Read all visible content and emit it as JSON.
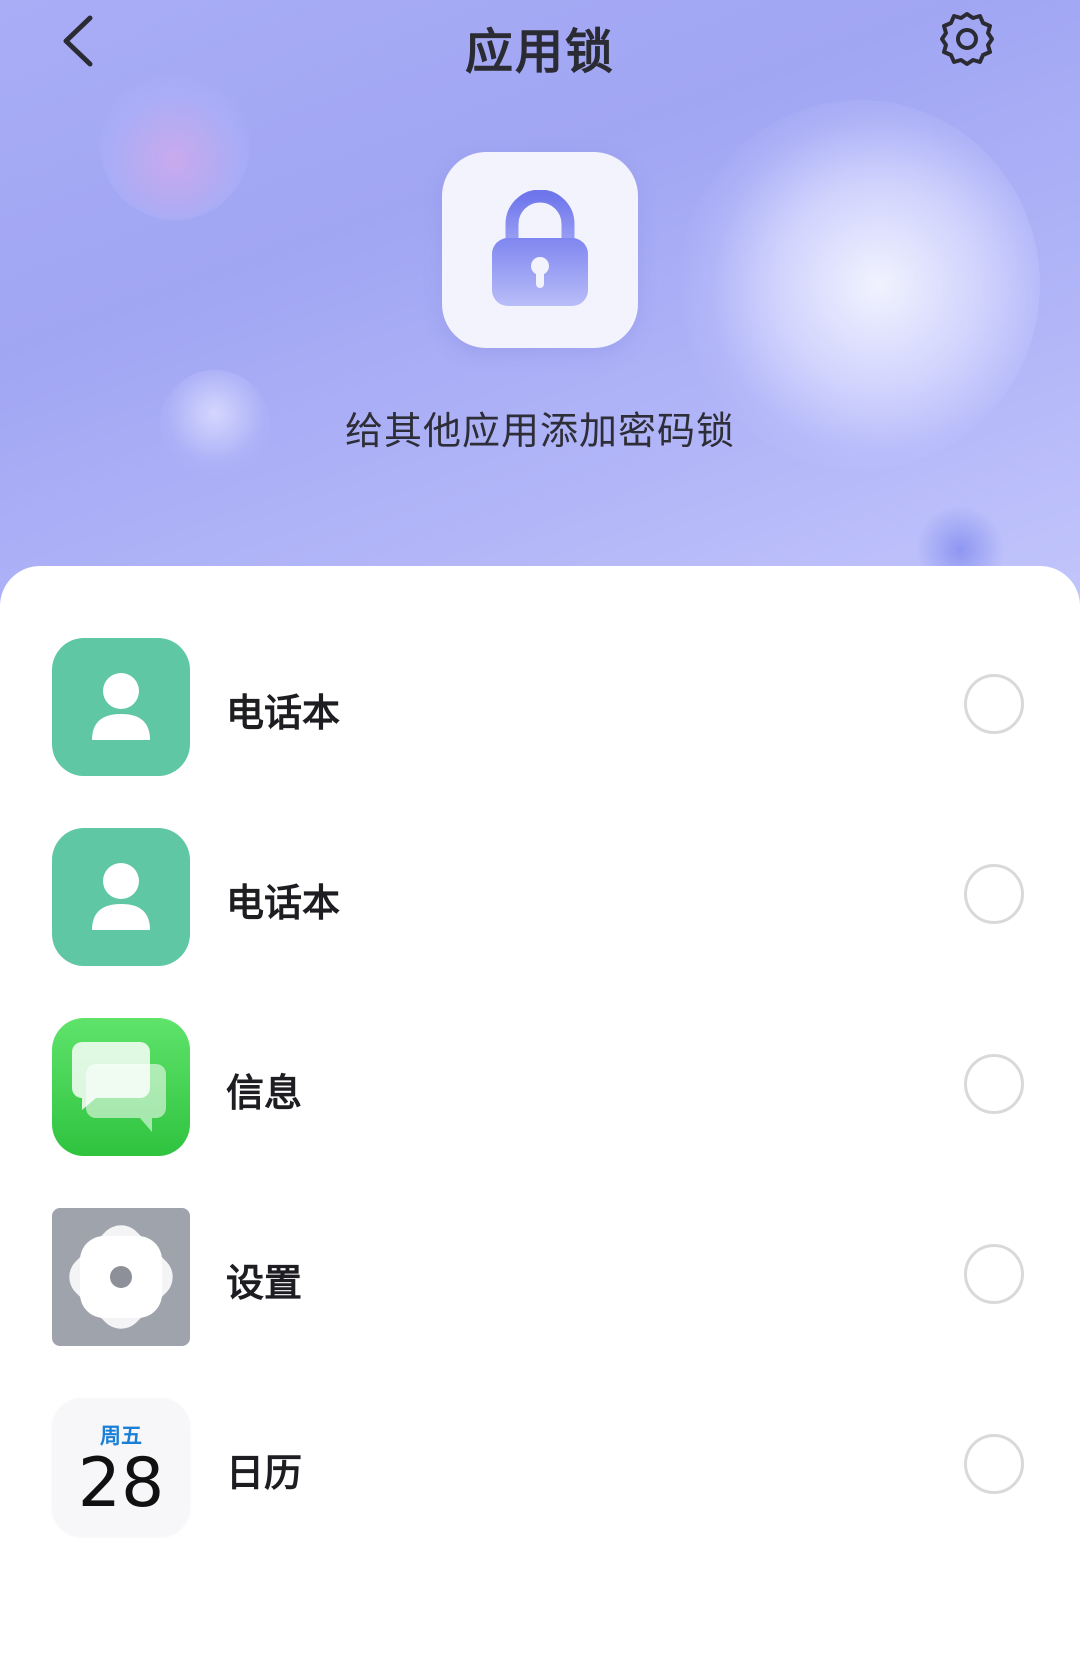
{
  "header": {
    "title": "应用锁",
    "back_icon": "chevron-left-icon",
    "settings_icon": "gear-icon"
  },
  "hero": {
    "icon": "lock-icon",
    "subtitle": "给其他应用添加密码锁"
  },
  "apps": [
    {
      "label": "电话本",
      "icon": "contacts-icon",
      "checked": false
    },
    {
      "label": "电话本",
      "icon": "contacts-icon",
      "checked": false
    },
    {
      "label": "信息",
      "icon": "messages-icon",
      "checked": false
    },
    {
      "label": "设置",
      "icon": "settings-app-icon",
      "checked": false
    },
    {
      "label": "日历",
      "icon": "calendar-icon",
      "checked": false,
      "calendar": {
        "weekday": "周五",
        "date": "28"
      }
    }
  ],
  "colors": {
    "hero_gradient_start": "#a9adf6",
    "hero_gradient_end": "#c3c6fb",
    "contacts_green": "#5fc7a3",
    "messages_green": "#3dcf4b",
    "settings_gray": "#9fa3ac",
    "calendar_accent": "#1a7fd6",
    "radio_border": "#d9d9dc"
  }
}
